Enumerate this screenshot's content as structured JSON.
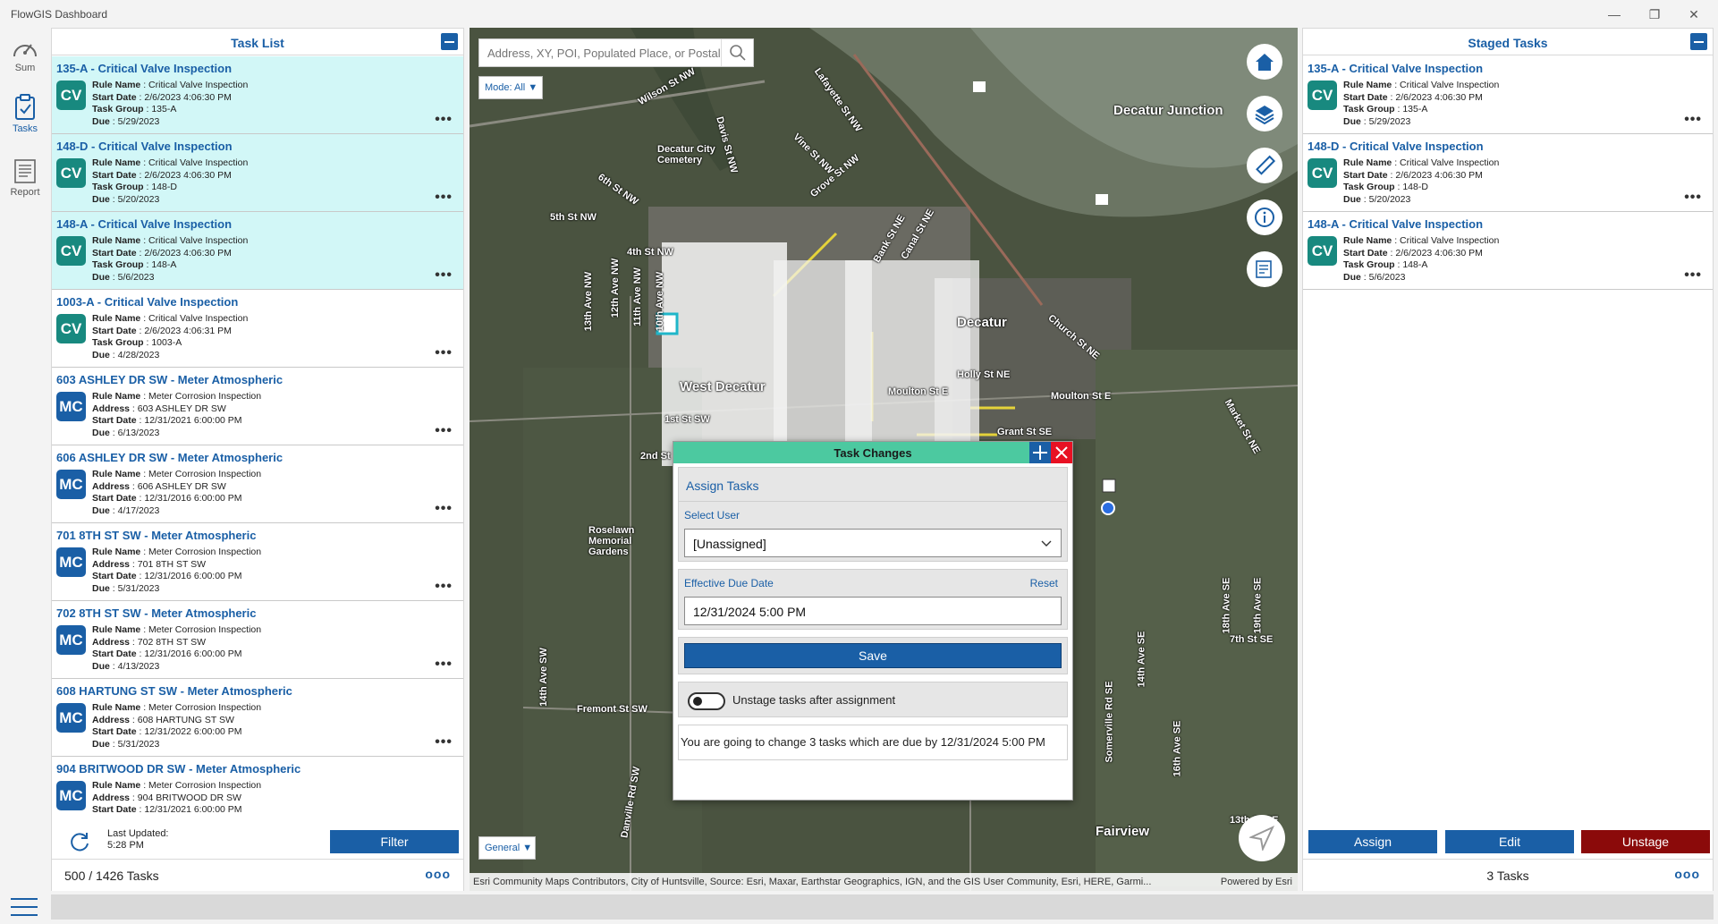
{
  "app": {
    "title": "FlowGIS Dashboard"
  },
  "rail": {
    "items": [
      {
        "label": "Sum"
      },
      {
        "label": "Tasks"
      },
      {
        "label": "Report"
      }
    ]
  },
  "task_list": {
    "title": "Task List",
    "items": [
      {
        "title": "135-A - Critical Valve Inspection",
        "badge": "CV",
        "fields": [
          [
            "Rule Name",
            "Critical Valve Inspection"
          ],
          [
            "Start Date",
            "2/6/2023 4:06:30 PM"
          ],
          [
            "Task Group",
            "135-A"
          ],
          [
            "Due",
            "5/29/2023"
          ]
        ]
      },
      {
        "title": "148-D - Critical Valve Inspection",
        "badge": "CV",
        "fields": [
          [
            "Rule Name",
            "Critical Valve Inspection"
          ],
          [
            "Start Date",
            "2/6/2023 4:06:30 PM"
          ],
          [
            "Task Group",
            "148-D"
          ],
          [
            "Due",
            "5/20/2023"
          ]
        ]
      },
      {
        "title": "148-A - Critical Valve Inspection",
        "badge": "CV",
        "fields": [
          [
            "Rule Name",
            "Critical Valve Inspection"
          ],
          [
            "Start Date",
            "2/6/2023 4:06:30 PM"
          ],
          [
            "Task Group",
            "148-A"
          ],
          [
            "Due",
            "5/6/2023"
          ]
        ]
      },
      {
        "title": "1003-A - Critical Valve Inspection",
        "badge": "CV",
        "fields": [
          [
            "Rule Name",
            "Critical Valve Inspection"
          ],
          [
            "Start Date",
            "2/6/2023 4:06:31 PM"
          ],
          [
            "Task Group",
            "1003-A"
          ],
          [
            "Due",
            "4/28/2023"
          ]
        ]
      },
      {
        "title": "603 ASHLEY DR SW - Meter Atmospheric",
        "badge": "MC",
        "fields": [
          [
            "Rule Name",
            "Meter Corrosion Inspection"
          ],
          [
            "Address",
            "603 ASHLEY DR SW"
          ],
          [
            "Start Date",
            "12/31/2021 6:00:00 PM"
          ],
          [
            "Due",
            "6/13/2023"
          ]
        ]
      },
      {
        "title": "606 ASHLEY DR SW - Meter Atmospheric",
        "badge": "MC",
        "fields": [
          [
            "Rule Name",
            "Meter Corrosion Inspection"
          ],
          [
            "Address",
            "606 ASHLEY DR SW"
          ],
          [
            "Start Date",
            "12/31/2016 6:00:00 PM"
          ],
          [
            "Due",
            "4/17/2023"
          ]
        ]
      },
      {
        "title": "701 8TH ST SW - Meter Atmospheric",
        "badge": "MC",
        "fields": [
          [
            "Rule Name",
            "Meter Corrosion Inspection"
          ],
          [
            "Address",
            "701 8TH ST SW"
          ],
          [
            "Start Date",
            "12/31/2016 6:00:00 PM"
          ],
          [
            "Due",
            "5/31/2023"
          ]
        ]
      },
      {
        "title": "702 8TH ST SW - Meter Atmospheric",
        "badge": "MC",
        "fields": [
          [
            "Rule Name",
            "Meter Corrosion Inspection"
          ],
          [
            "Address",
            "702 8TH ST SW"
          ],
          [
            "Start Date",
            "12/31/2016 6:00:00 PM"
          ],
          [
            "Due",
            "4/13/2023"
          ]
        ]
      },
      {
        "title": "608 HARTUNG ST SW - Meter Atmospheric",
        "badge": "MC",
        "fields": [
          [
            "Rule Name",
            "Meter Corrosion Inspection"
          ],
          [
            "Address",
            "608 HARTUNG ST SW"
          ],
          [
            "Start Date",
            "12/31/2022 6:00:00 PM"
          ],
          [
            "Due",
            "5/31/2023"
          ]
        ]
      },
      {
        "title": "904 BRITWOOD DR SW - Meter Atmospheric",
        "badge": "MC",
        "fields": [
          [
            "Rule Name",
            "Meter Corrosion Inspection"
          ],
          [
            "Address",
            "904 BRITWOOD DR SW"
          ],
          [
            "Start Date",
            "12/31/2021 6:00:00 PM"
          ]
        ]
      }
    ],
    "last_updated_label": "Last Updated:",
    "last_updated_value": "5:28 PM",
    "filter_label": "Filter",
    "count_text": "500 / 1426  Tasks"
  },
  "map": {
    "search_placeholder": "Address, XY, POI, Populated Place, or Postal",
    "mode_label": "Mode: All",
    "general_label": "General",
    "attribution": "Esri Community Maps Contributors, City of Huntsville, Source: Esri, Maxar, Earthstar Geographics, IGN, and the GIS User Community, Esri, HERE, Garmi...",
    "powered_by": "Powered by Esri",
    "labels": [
      "Decatur Junction",
      "Decatur",
      "West Decatur",
      "Decatur City Cemetery",
      "Roselawn Memorial Gardens",
      "Fairview",
      "Wilson St NW",
      "Lafayette St NW",
      "Vine St NW",
      "Grove St NW",
      "Davis St NW",
      "6th St NW",
      "5th St NW",
      "4th St NW",
      "13th Ave NW",
      "12th Ave NW",
      "11th Ave NW",
      "10th Ave NW",
      "1st St SW",
      "2nd St",
      "Moulton St E",
      "Market St NE",
      "Church St NE",
      "Grant St SE",
      "7th St SE",
      "13th St SE",
      "14th Ave SW",
      "Fremont St SW",
      "Danville Rd SW",
      "Somerville Rd SE",
      "14th Ave SE",
      "16th Ave SE",
      "18th Ave SE",
      "19th Ave SE",
      "Holly St NE",
      "Moulton St E",
      "Bank St NE",
      "Canal St NE"
    ]
  },
  "dialog": {
    "title": "Task Changes",
    "section_title": "Assign Tasks",
    "select_user_label": "Select User",
    "select_user_value": "[Unassigned]",
    "due_date_label": "Effective Due Date",
    "reset_label": "Reset",
    "due_date_value": "12/31/2024 5:00 PM",
    "save_label": "Save",
    "toggle_label": "Unstage tasks after assignment",
    "info_text": "You are going to change 3 tasks which are due by 12/31/2024 5:00 PM"
  },
  "staged": {
    "title": "Staged Tasks",
    "items": [
      {
        "title": "135-A - Critical Valve Inspection",
        "badge": "CV",
        "fields": [
          [
            "Rule Name",
            "Critical Valve Inspection"
          ],
          [
            "Start Date",
            "2/6/2023 4:06:30 PM"
          ],
          [
            "Task Group",
            "135-A"
          ],
          [
            "Due",
            "5/29/2023"
          ]
        ]
      },
      {
        "title": "148-D - Critical Valve Inspection",
        "badge": "CV",
        "fields": [
          [
            "Rule Name",
            "Critical Valve Inspection"
          ],
          [
            "Start Date",
            "2/6/2023 4:06:30 PM"
          ],
          [
            "Task Group",
            "148-D"
          ],
          [
            "Due",
            "5/20/2023"
          ]
        ]
      },
      {
        "title": "148-A - Critical Valve Inspection",
        "badge": "CV",
        "fields": [
          [
            "Rule Name",
            "Critical Valve Inspection"
          ],
          [
            "Start Date",
            "2/6/2023 4:06:30 PM"
          ],
          [
            "Task Group",
            "148-A"
          ],
          [
            "Due",
            "5/6/2023"
          ]
        ]
      }
    ],
    "assign_label": "Assign",
    "edit_label": "Edit",
    "unstage_label": "Unstage",
    "count_text": "3 Tasks"
  },
  "colors": {
    "accent": "#1a5fa6",
    "selected_row": "#d2f7f7",
    "cv_badge": "#18897f",
    "mc_badge": "#1a5fa6",
    "unstage": "#8b0a0a",
    "dialog_header": "#4cc9a0"
  }
}
